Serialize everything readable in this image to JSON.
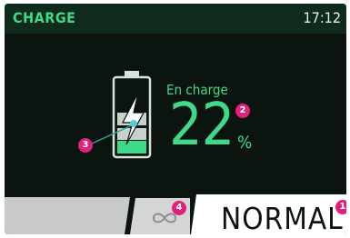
{
  "header": {
    "title": "CHARGE",
    "time": "17:12"
  },
  "battery": {
    "status_label": "En charge",
    "charge_value": "22",
    "charge_unit": "%",
    "fill_fraction": 0.22
  },
  "bottom": {
    "mode_label": "NORMAL",
    "mode_icon": "infinity-loop-icon"
  },
  "callouts": [
    "1",
    "2",
    "3",
    "4"
  ],
  "colors": {
    "accent": "#3fd98a",
    "background": "#0c1410",
    "header_bg": "#0f2b1b",
    "callout": "#e0207a"
  }
}
